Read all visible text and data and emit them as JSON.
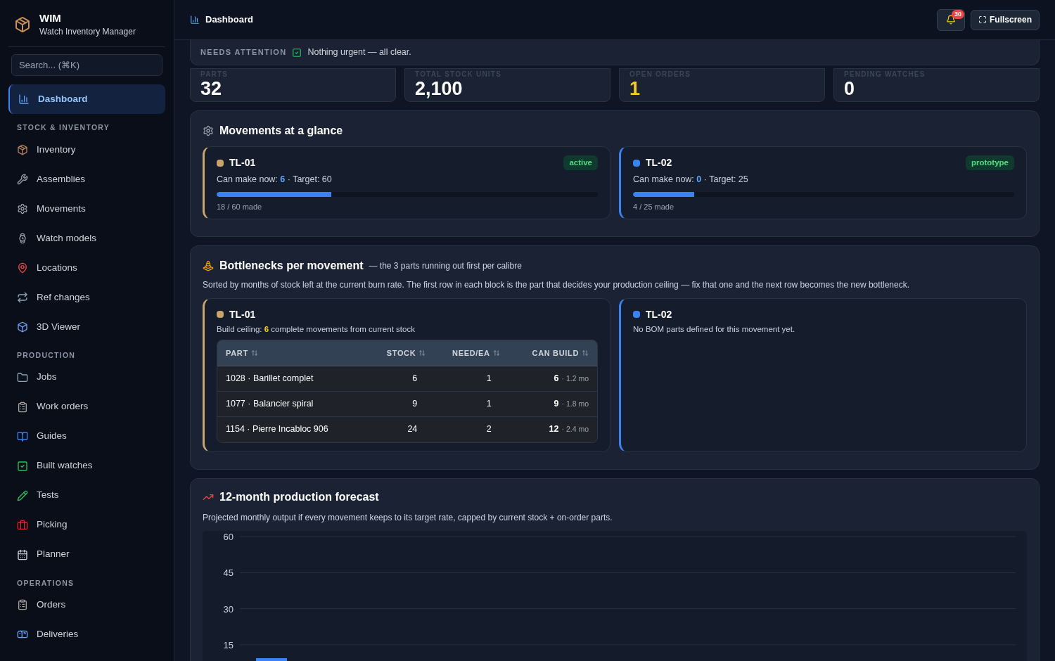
{
  "app": {
    "name": "WIM",
    "subtitle": "Watch Inventory Manager"
  },
  "sidebar": {
    "search": {
      "placeholder": "Search... (⌘K)"
    },
    "sections": [
      {
        "items": [
          {
            "label": "Dashboard",
            "selected": true
          }
        ]
      },
      {
        "heading": "STOCK & INVENTORY",
        "items": [
          {
            "label": "Inventory",
            "selected": false
          },
          {
            "label": "Assemblies",
            "selected": false
          },
          {
            "label": "Movements",
            "selected": false
          },
          {
            "label": "Watch models",
            "selected": false
          },
          {
            "label": "Locations",
            "selected": false
          },
          {
            "label": "Ref changes",
            "selected": false
          },
          {
            "label": "3D Viewer",
            "selected": false
          }
        ]
      },
      {
        "heading": "PRODUCTION",
        "items": [
          {
            "label": "Jobs",
            "selected": false
          },
          {
            "label": "Work orders",
            "selected": false
          },
          {
            "label": "Guides",
            "selected": false
          },
          {
            "label": "Built watches",
            "selected": false
          },
          {
            "label": "Tests",
            "selected": false
          },
          {
            "label": "Picking",
            "selected": false
          },
          {
            "label": "Planner",
            "selected": false
          }
        ]
      },
      {
        "heading": "OPERATIONS",
        "items": [
          {
            "label": "Orders",
            "selected": false
          },
          {
            "label": "Deliveries",
            "selected": false
          }
        ]
      }
    ]
  },
  "topbar": {
    "title": "Dashboard",
    "notifications": "30",
    "fullscreen": "Fullscreen"
  },
  "attention": {
    "label": "NEEDS ATTENTION",
    "message": "Nothing urgent — all clear."
  },
  "stats": [
    {
      "label": "PARTS",
      "value": "32",
      "highlight": false
    },
    {
      "label": "TOTAL STOCK UNITS",
      "value": "2,100",
      "highlight": false
    },
    {
      "label": "OPEN ORDERS",
      "value": "1",
      "highlight": true
    },
    {
      "label": "PENDING WATCHES",
      "value": "0",
      "highlight": false
    }
  ],
  "movements": {
    "title": "Movements at a glance",
    "cards": [
      {
        "name": "TL-01",
        "color": "#c9a46a",
        "status": "active",
        "summary": "Can make now: **6** · Target: 60",
        "level": 0.3,
        "made": "18 / 60 made"
      },
      {
        "name": "TL-02",
        "color": "#3b82f6",
        "status": "prototype",
        "summary": "Can make now: **0** · Target: 25",
        "level": 0.16,
        "made": "4 / 25 made"
      }
    ]
  },
  "bottlenecks": {
    "title": "Bottlenecks per movement",
    "subtitle": "— the 3 parts running out first per calibre",
    "description": "Sorted by months of stock left at the current burn rate. The first row in each block is the part that decides your production ceiling — fix that one and the next row becomes the new bottleneck.",
    "blocks": [
      {
        "name": "TL-01",
        "color": "#c9a46a",
        "kind": "table",
        "caption": "Build ceiling: **6** complete movements from current stock",
        "columns": [
          "PART",
          "STOCK",
          "NEED/EA",
          "CAN BUILD"
        ],
        "rows": [
          {
            "part": "1028 · Barillet complet",
            "stock": "6",
            "need": "1",
            "can_build": "6",
            "months": "· 1.2 mo"
          },
          {
            "part": "1077 · Balancier spiral",
            "stock": "9",
            "need": "1",
            "can_build": "9",
            "months": "· 1.8 mo"
          },
          {
            "part": "1154 · Pierre Incabloc 906",
            "stock": "24",
            "need": "2",
            "can_build": "12",
            "months": "· 2.4 mo"
          }
        ]
      },
      {
        "name": "TL-02",
        "color": "#3b82f6",
        "kind": "empty",
        "caption": "No BOM parts defined for this movement yet."
      }
    ]
  },
  "forecast": {
    "title": "12-month production forecast",
    "description": "Projected monthly output if every movement keeps to its target rate, capped by current stock + on-order parts.",
    "axis_labels": [
      "60",
      "45",
      "30",
      "15"
    ]
  }
}
